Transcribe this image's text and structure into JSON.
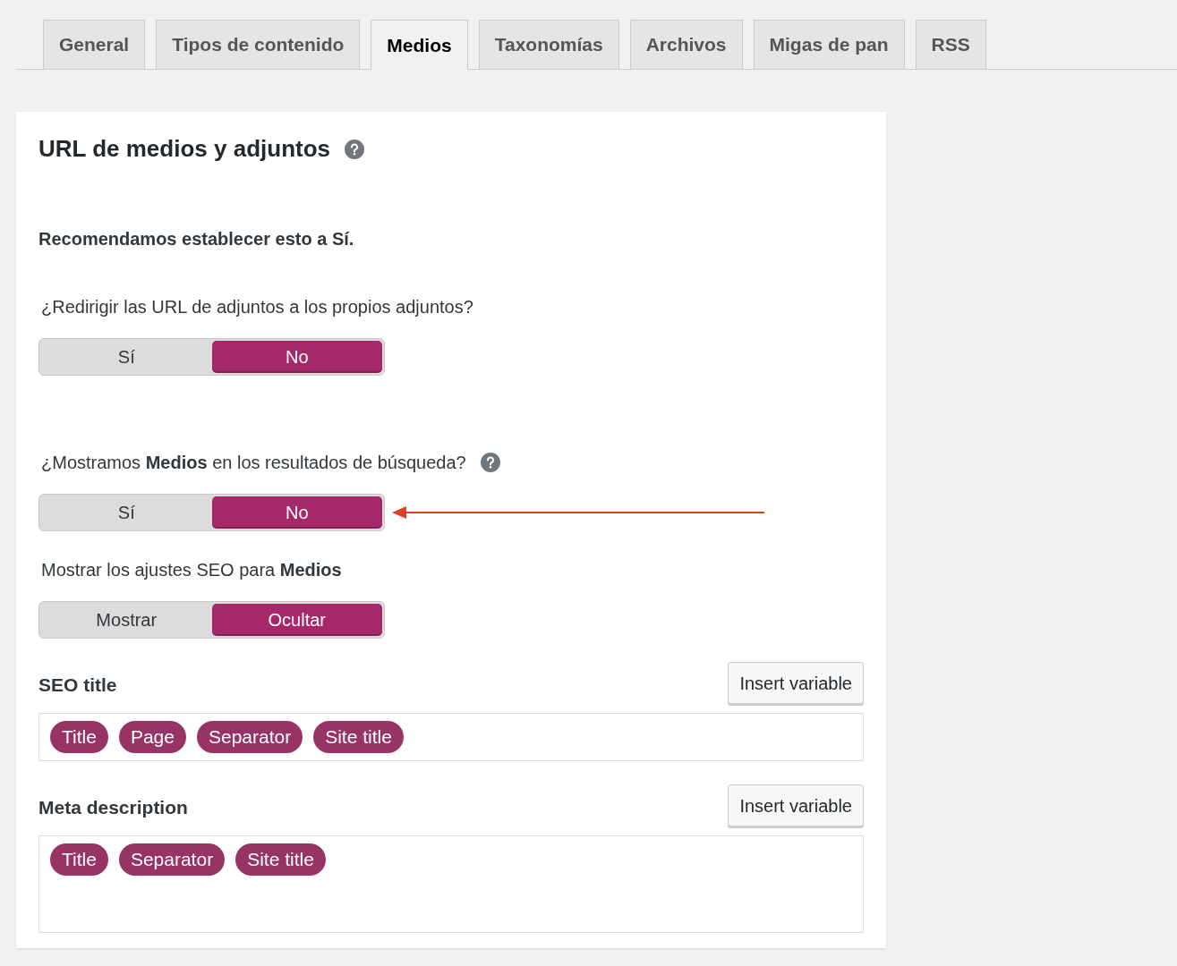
{
  "tabs": [
    {
      "label": "General",
      "selected": false
    },
    {
      "label": "Tipos de contenido",
      "selected": false
    },
    {
      "label": "Medios",
      "selected": true
    },
    {
      "label": "Taxonomías",
      "selected": false
    },
    {
      "label": "Archivos",
      "selected": false
    },
    {
      "label": "Migas de pan",
      "selected": false
    },
    {
      "label": "RSS",
      "selected": false
    }
  ],
  "card": {
    "title": "URL de medios y adjuntos",
    "help": true,
    "items": [
      {
        "kind": "note",
        "text": "Recomendamos establecer esto a Sí."
      },
      {
        "kind": "toggle",
        "label": "¿Redirigir las URL de adjuntos a los propios adjuntos?",
        "help": false,
        "options": [
          {
            "label": "Sí",
            "selected": false
          },
          {
            "label": "No",
            "selected": true
          }
        ]
      },
      {
        "kind": "toggle",
        "label": "¿Mostramos **Medios** en los resultados de búsqueda?",
        "help": true,
        "options": [
          {
            "label": "Sí",
            "selected": false
          },
          {
            "label": "No",
            "selected": true
          }
        ]
      },
      {
        "kind": "toggle",
        "label": "Mostrar los ajustes SEO para **Medios**",
        "help": false,
        "options": [
          {
            "label": "Mostrar",
            "selected": false
          },
          {
            "label": "Ocultar",
            "selected": true
          }
        ]
      }
    ],
    "fields": [
      {
        "label": "SEO title",
        "button": "Insert variable",
        "tags": [
          "Title",
          "Page",
          "Separator",
          "Site title"
        ]
      },
      {
        "label": "Meta description",
        "button": "Insert variable",
        "tags": [
          "Title",
          "Separator",
          "Site title"
        ]
      }
    ]
  }
}
